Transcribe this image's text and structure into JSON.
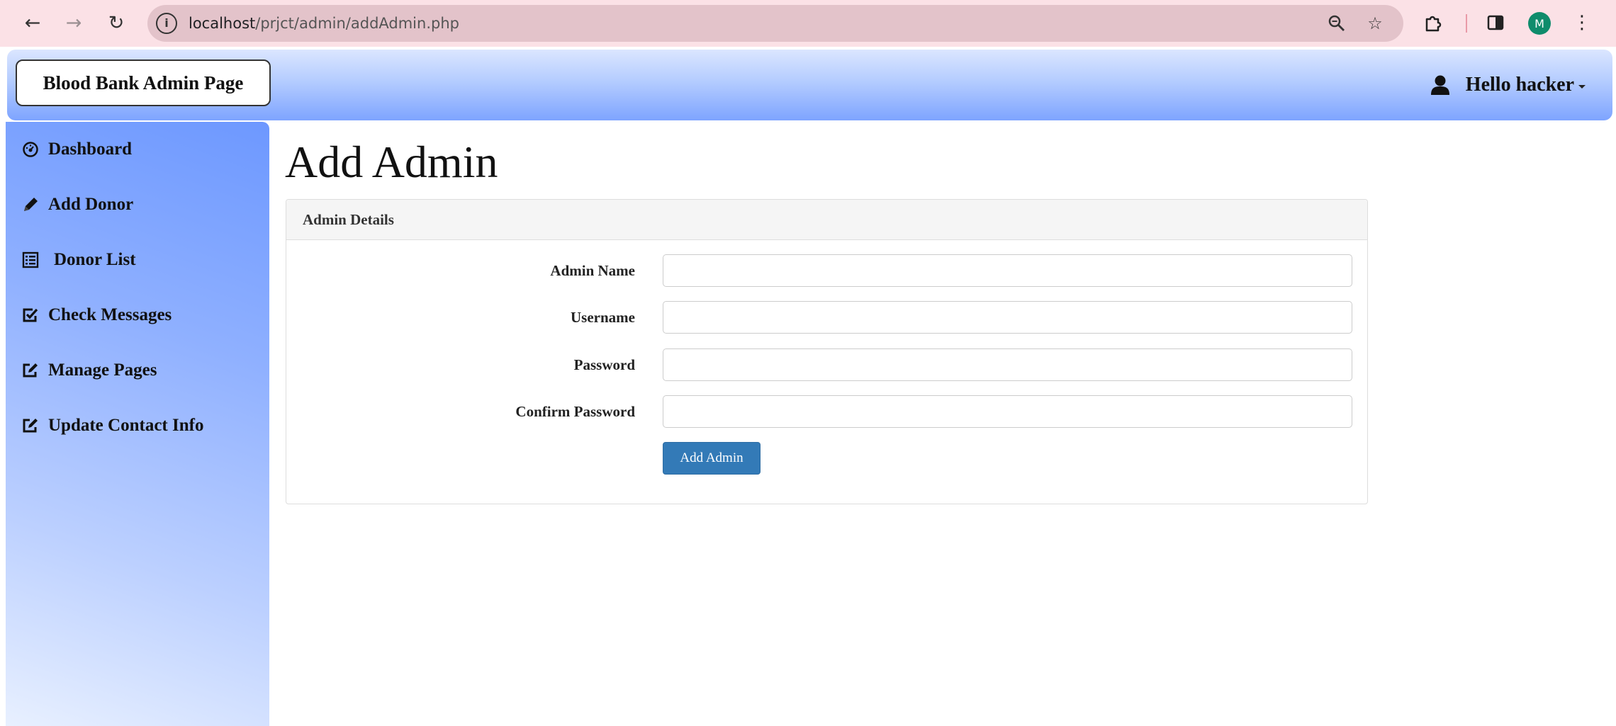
{
  "browser": {
    "url_host": "localhost",
    "url_path": "/prjct/admin/addAdmin.php",
    "profile_initial": "M"
  },
  "navbar": {
    "brand": "Blood Bank Admin Page",
    "greeting": "Hello hacker"
  },
  "sidebar": {
    "items": [
      {
        "label": "Dashboard",
        "icon": "dashboard-icon"
      },
      {
        "label": "Add Donor",
        "icon": "pencil-icon"
      },
      {
        "label": "Donor List",
        "icon": "list-icon"
      },
      {
        "label": "Check Messages",
        "icon": "check-square-icon"
      },
      {
        "label": "Manage Pages",
        "icon": "edit-square-icon"
      },
      {
        "label": "Update Contact Info",
        "icon": "edit-square-icon"
      }
    ]
  },
  "main": {
    "title": "Add Admin",
    "panel_heading": "Admin Details",
    "fields": [
      {
        "label": "Admin Name",
        "value": ""
      },
      {
        "label": "Username",
        "value": ""
      },
      {
        "label": "Password",
        "value": ""
      },
      {
        "label": "Confirm Password",
        "value": ""
      }
    ],
    "submit_label": "Add Admin"
  },
  "colors": {
    "primary_button": "#337ab7",
    "sidebar_gradient_top": "#6d98ff",
    "browser_chrome": "#fbe1e6"
  }
}
